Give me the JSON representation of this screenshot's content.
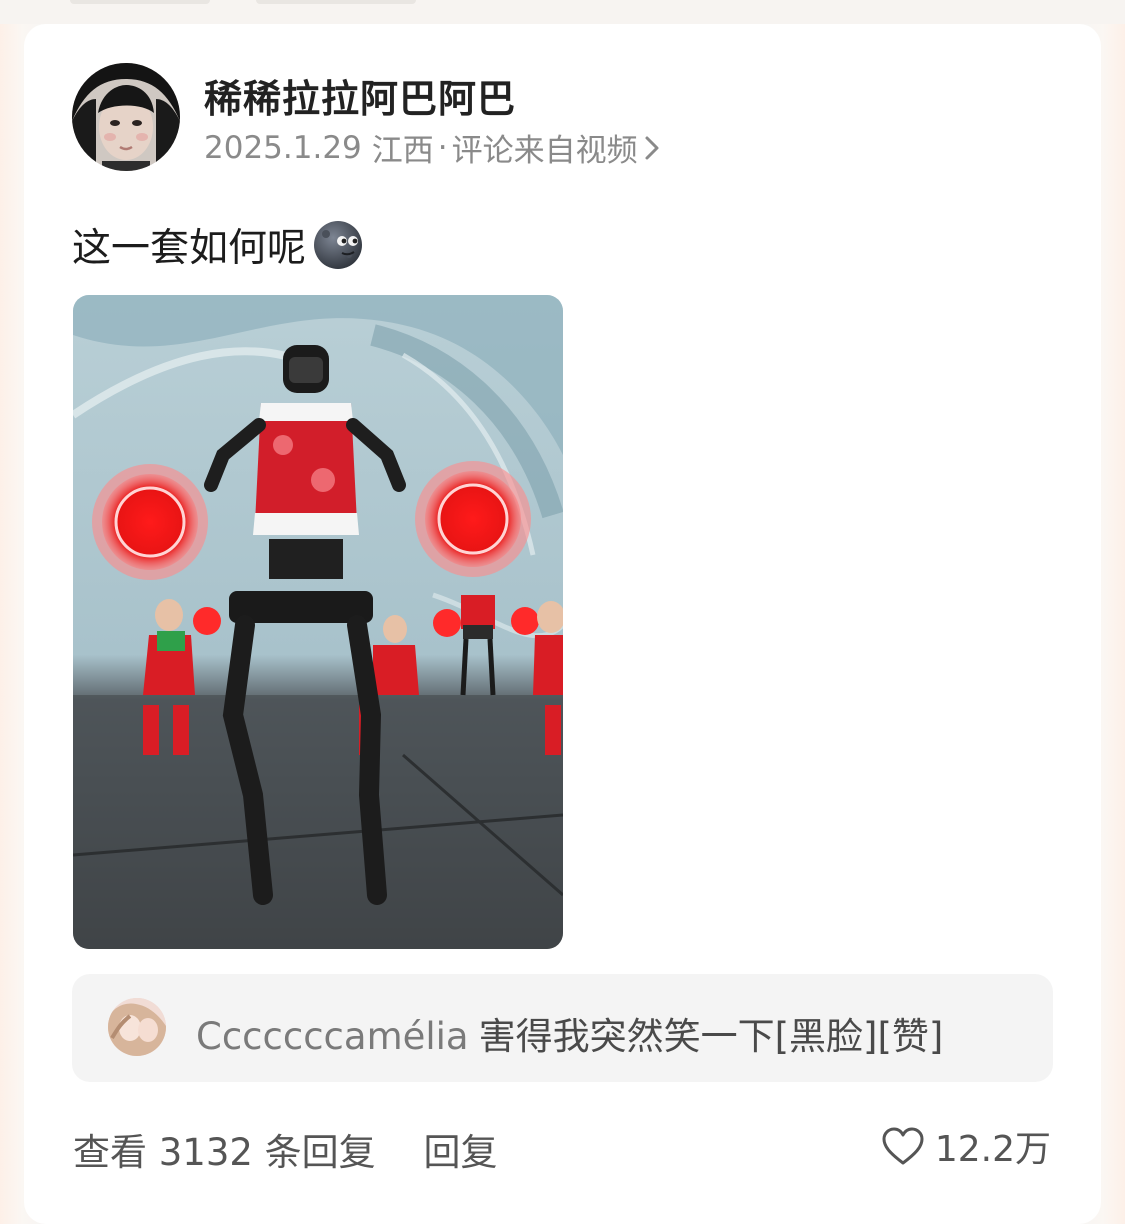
{
  "post": {
    "username": "稀稀拉拉阿巴阿巴",
    "date": "2025.1.29",
    "location": "江西",
    "separator": "·",
    "source": "评论来自视频",
    "text": "这一套如何呢",
    "emoji": "dark-moon-face-emoji"
  },
  "reply_preview": {
    "user": "Cccccccamélia",
    "content": "害得我突然笑一下[黑脸][赞]"
  },
  "footer": {
    "view_replies": "查看 3132 条回复",
    "reply": "回复",
    "likes": "12.2万"
  },
  "colors": {
    "card_bg": "#ffffff",
    "reply_bg": "#f4f4f4",
    "meta_text": "#8a8a8a",
    "accent_red": "#e8141e"
  },
  "icons": [
    "chevron-right-icon",
    "heart-icon"
  ]
}
